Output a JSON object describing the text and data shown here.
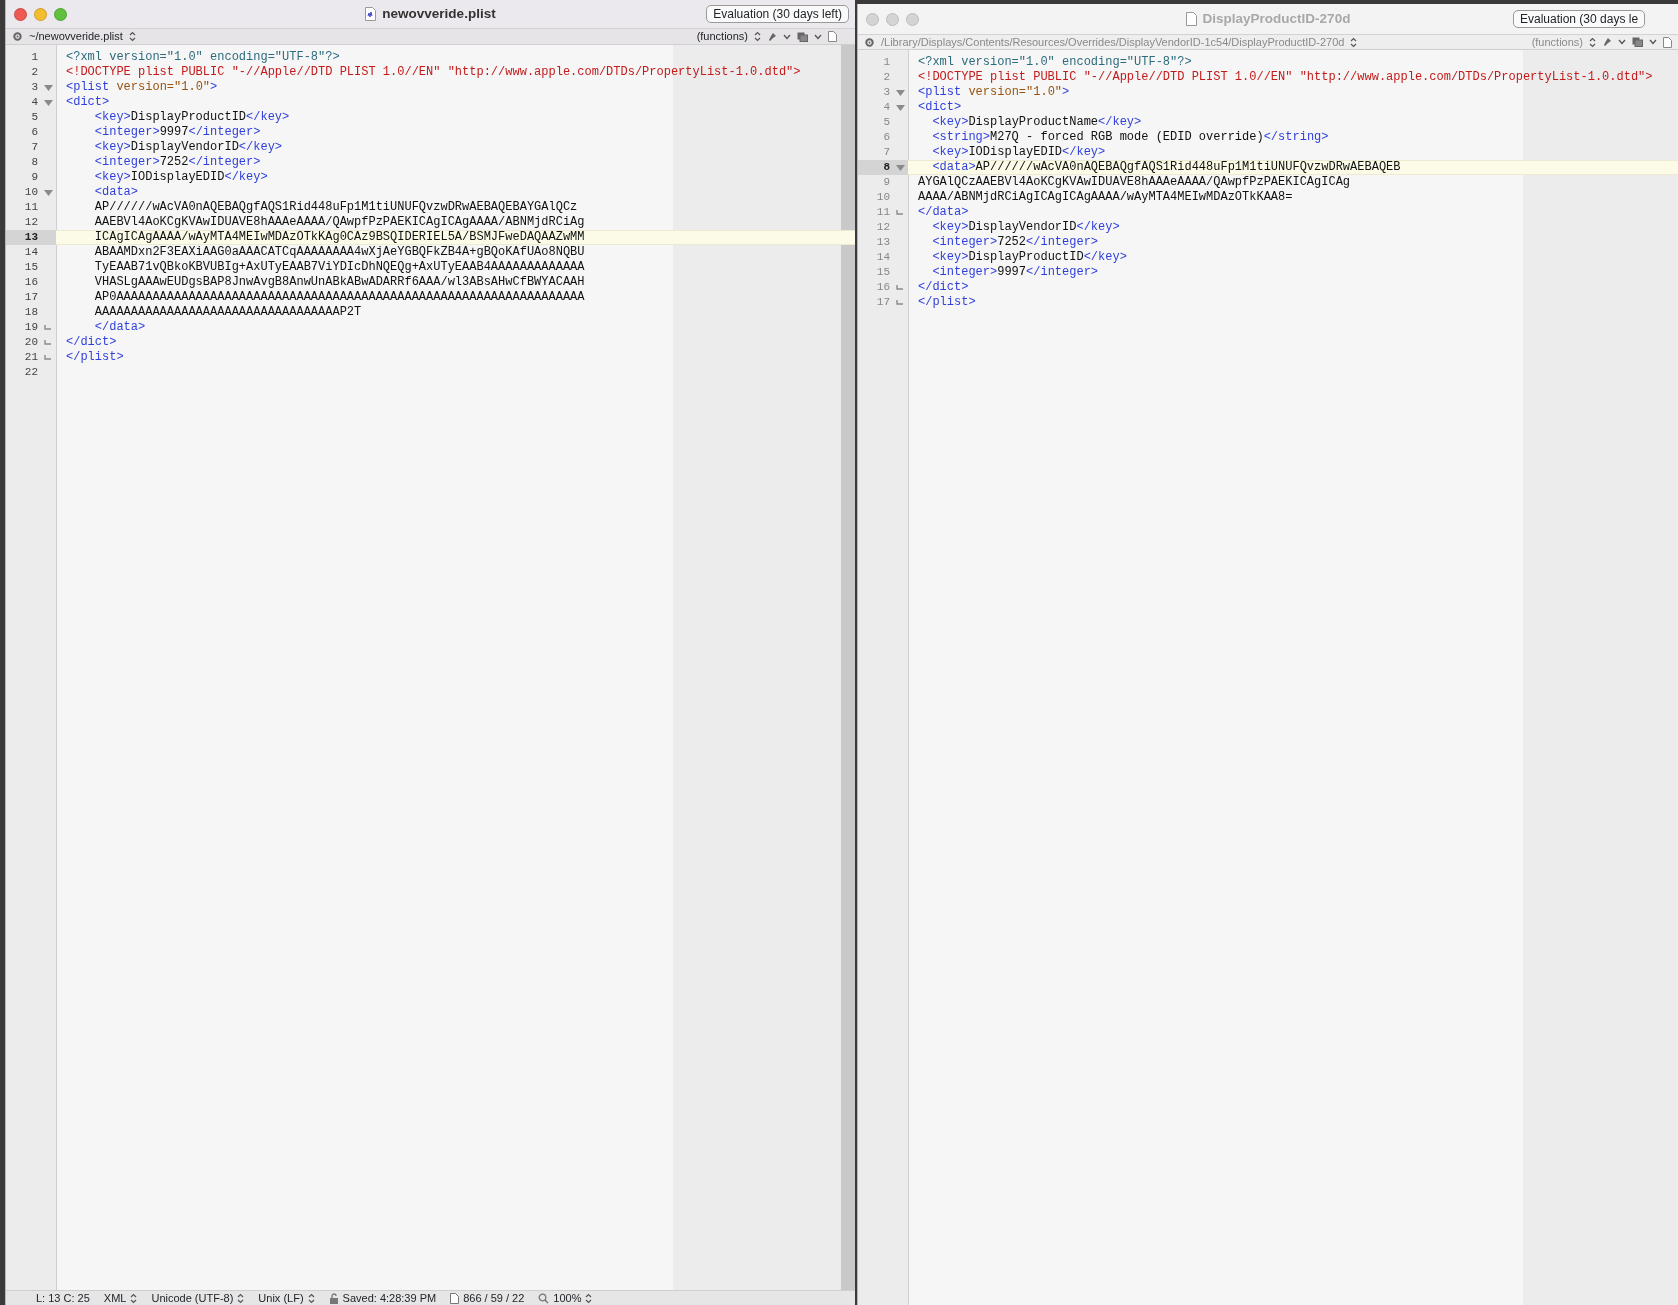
{
  "windows": [
    {
      "title": "newovveride.plist",
      "active": true,
      "badge": "Evaluation (30 days left)",
      "path": "~/newovveride.plist",
      "functions": "(functions)",
      "lines": [
        {
          "number": "1",
          "current": false,
          "fold_open": false,
          "fold_end": false,
          "tokens": [
            {
              "kind": "pi",
              "text": "<?xml version=\"1.0\" encoding=\"UTF-8\"?>"
            }
          ]
        },
        {
          "number": "2",
          "current": false,
          "fold_open": false,
          "fold_end": false,
          "tokens": [
            {
              "kind": "doctype",
              "text": "<!DOCTYPE plist PUBLIC \"-//Apple//DTD PLIST 1.0//EN\" \"http://www.apple.com/DTDs/PropertyList-1.0.dtd\">"
            }
          ]
        },
        {
          "number": "3",
          "current": false,
          "fold_open": true,
          "fold_end": false,
          "tokens": [
            {
              "kind": "tag",
              "text": "<plist"
            },
            {
              "kind": "attr",
              "text": " version=\"1.0\""
            },
            {
              "kind": "tag",
              "text": ">"
            }
          ]
        },
        {
          "number": "4",
          "current": false,
          "fold_open": true,
          "fold_end": false,
          "tokens": [
            {
              "kind": "tag",
              "text": "<dict>"
            }
          ]
        },
        {
          "number": "5",
          "current": false,
          "fold_open": false,
          "fold_end": false,
          "tokens": [
            {
              "kind": "tag",
              "text": "    <key>"
            },
            {
              "kind": "text",
              "text": "DisplayProductID"
            },
            {
              "kind": "tag",
              "text": "</key>"
            }
          ]
        },
        {
          "number": "6",
          "current": false,
          "fold_open": false,
          "fold_end": false,
          "tokens": [
            {
              "kind": "tag",
              "text": "    <integer>"
            },
            {
              "kind": "text",
              "text": "9997"
            },
            {
              "kind": "tag",
              "text": "</integer>"
            }
          ]
        },
        {
          "number": "7",
          "current": false,
          "fold_open": false,
          "fold_end": false,
          "tokens": [
            {
              "kind": "tag",
              "text": "    <key>"
            },
            {
              "kind": "text",
              "text": "DisplayVendorID"
            },
            {
              "kind": "tag",
              "text": "</key>"
            }
          ]
        },
        {
          "number": "8",
          "current": false,
          "fold_open": false,
          "fold_end": false,
          "tokens": [
            {
              "kind": "tag",
              "text": "    <integer>"
            },
            {
              "kind": "text",
              "text": "7252"
            },
            {
              "kind": "tag",
              "text": "</integer>"
            }
          ]
        },
        {
          "number": "9",
          "current": false,
          "fold_open": false,
          "fold_end": false,
          "tokens": [
            {
              "kind": "tag",
              "text": "    <key>"
            },
            {
              "kind": "text",
              "text": "IODisplayEDID"
            },
            {
              "kind": "tag",
              "text": "</key>"
            }
          ]
        },
        {
          "number": "10",
          "current": false,
          "fold_open": true,
          "fold_end": false,
          "tokens": [
            {
              "kind": "tag",
              "text": "    <data>"
            }
          ]
        },
        {
          "number": "11",
          "current": false,
          "fold_open": false,
          "fold_end": false,
          "tokens": [
            {
              "kind": "text",
              "text": "    AP//////wAcVA0nAQEBAQgfAQS1Rid448uFp1M1tiUNUFQvzwDRwAEBAQEBAYGAlQCz"
            }
          ]
        },
        {
          "number": "12",
          "current": false,
          "fold_open": false,
          "fold_end": false,
          "tokens": [
            {
              "kind": "text",
              "text": "    AAEBVl4AoKCgKVAwIDUAVE8hAAAeAAAA/QAwpfPzPAEKICAgICAgAAAA/ABNMjdRCiAg"
            }
          ]
        },
        {
          "number": "13",
          "current": true,
          "fold_open": false,
          "fold_end": false,
          "tokens": [
            {
              "kind": "text",
              "text": "    ICAgICAgAAAA/wAyMTA4MEIwMDAzOTkKAg0CAz9BSQIDERIEL5A/BSMJFweDAQAAZwMM"
            }
          ]
        },
        {
          "number": "14",
          "current": false,
          "fold_open": false,
          "fold_end": false,
          "tokens": [
            {
              "kind": "text",
              "text": "    ABAAMDxn2F3EAXiAAG0aAAACATCqAAAAAAAA4wXjAeYGBQFkZB4A+gBQoKAfUAo8NQBU"
            }
          ]
        },
        {
          "number": "15",
          "current": false,
          "fold_open": false,
          "fold_end": false,
          "tokens": [
            {
              "kind": "text",
              "text": "    TyEAAB71vQBkoKBVUBIg+AxUTyEAAB7ViYDIcDhNQEQg+AxUTyEAAB4AAAAAAAAAAAAA"
            }
          ]
        },
        {
          "number": "16",
          "current": false,
          "fold_open": false,
          "fold_end": false,
          "tokens": [
            {
              "kind": "text",
              "text": "    VHASLgAAAwEUDgsBAP8JnwAvgB8AnwUnABkABwADARRf6AAA/wl3ABsAHwCfBWYACAAH"
            }
          ]
        },
        {
          "number": "17",
          "current": false,
          "fold_open": false,
          "fold_end": false,
          "tokens": [
            {
              "kind": "text",
              "text": "    AP0AAAAAAAAAAAAAAAAAAAAAAAAAAAAAAAAAAAAAAAAAAAAAAAAAAAAAAAAAAAAAAAAA"
            }
          ]
        },
        {
          "number": "18",
          "current": false,
          "fold_open": false,
          "fold_end": false,
          "tokens": [
            {
              "kind": "text",
              "text": "    AAAAAAAAAAAAAAAAAAAAAAAAAAAAAAAAAAP2T"
            }
          ]
        },
        {
          "number": "19",
          "current": false,
          "fold_open": false,
          "fold_end": true,
          "tokens": [
            {
              "kind": "tag",
              "text": "    </data>"
            }
          ]
        },
        {
          "number": "20",
          "current": false,
          "fold_open": false,
          "fold_end": true,
          "tokens": [
            {
              "kind": "tag",
              "text": "</dict>"
            }
          ]
        },
        {
          "number": "21",
          "current": false,
          "fold_open": false,
          "fold_end": true,
          "tokens": [
            {
              "kind": "tag",
              "text": "</plist>"
            }
          ]
        },
        {
          "number": "22",
          "current": false,
          "fold_open": false,
          "fold_end": false
        }
      ],
      "status_bar": [
        {
          "text": "L: 13 C: 25",
          "popup": false
        },
        {
          "text": "XML",
          "popup": true
        },
        {
          "text": "Unicode (UTF-8)",
          "popup": true
        },
        {
          "text": "Unix (LF)",
          "popup": true
        },
        {
          "text": "Saved: 4:28:39 PM",
          "popup": false
        },
        {
          "text": "866 / 59 / 22",
          "popup": false
        },
        {
          "text": "100%",
          "popup": true
        }
      ]
    },
    {
      "title": "DisplayProductID-270d",
      "active": false,
      "badge": "Evaluation (30 days le",
      "path": "/Library/Displays/Contents/Resources/Overrides/DisplayVendorID-1c54/DisplayProductID-270d",
      "functions": "(functions)",
      "lines": [
        {
          "number": "1",
          "current": false,
          "fold_open": false,
          "fold_end": false,
          "tokens": [
            {
              "kind": "pi",
              "text": "<?xml version=\"1.0\" encoding=\"UTF-8\"?>"
            }
          ]
        },
        {
          "number": "2",
          "current": false,
          "fold_open": false,
          "fold_end": false,
          "tokens": [
            {
              "kind": "doctype",
              "text": "<!DOCTYPE plist PUBLIC \"-//Apple//DTD PLIST 1.0//EN\" \"http://www.apple.com/DTDs/PropertyList-1.0.dtd\">"
            }
          ]
        },
        {
          "number": "3",
          "current": false,
          "fold_open": true,
          "fold_end": false,
          "tokens": [
            {
              "kind": "tag",
              "text": "<plist"
            },
            {
              "kind": "attr",
              "text": " version=\"1.0\""
            },
            {
              "kind": "tag",
              "text": ">"
            }
          ]
        },
        {
          "number": "4",
          "current": false,
          "fold_open": true,
          "fold_end": false,
          "tokens": [
            {
              "kind": "tag",
              "text": "<dict>"
            }
          ]
        },
        {
          "number": "5",
          "current": false,
          "fold_open": false,
          "fold_end": false,
          "tokens": [
            {
              "kind": "tag",
              "text": "  <key>"
            },
            {
              "kind": "text",
              "text": "DisplayProductName"
            },
            {
              "kind": "tag",
              "text": "</key>"
            }
          ]
        },
        {
          "number": "6",
          "current": false,
          "fold_open": false,
          "fold_end": false,
          "tokens": [
            {
              "kind": "tag",
              "text": "  <string>"
            },
            {
              "kind": "text",
              "text": "M27Q - forced RGB mode (EDID override)"
            },
            {
              "kind": "tag",
              "text": "</string>"
            }
          ]
        },
        {
          "number": "7",
          "current": false,
          "fold_open": false,
          "fold_end": false,
          "tokens": [
            {
              "kind": "tag",
              "text": "  <key>"
            },
            {
              "kind": "text",
              "text": "IODisplayEDID"
            },
            {
              "kind": "tag",
              "text": "</key>"
            }
          ]
        },
        {
          "number": "8",
          "current": true,
          "fold_open": true,
          "fold_end": false,
          "tokens": [
            {
              "kind": "tag",
              "text": "  <data>"
            },
            {
              "kind": "text",
              "text": "AP//////wAcVA0nAQEBAQgfAQS1Rid448uFp1M1tiUNUFQvzwDRwAEBAQEB"
            }
          ]
        },
        {
          "number": "9",
          "current": false,
          "fold_open": false,
          "fold_end": false,
          "tokens": [
            {
              "kind": "text",
              "text": "AYGAlQCzAAEBVl4AoKCgKVAwIDUAVE8hAAAeAAAA/QAwpfPzPAEKICAgICAg"
            }
          ]
        },
        {
          "number": "10",
          "current": false,
          "fold_open": false,
          "fold_end": false,
          "tokens": [
            {
              "kind": "text",
              "text": "AAAA/ABNMjdRCiAgICAgICAgAAAA/wAyMTA4MEIwMDAzOTkKAA8="
            }
          ]
        },
        {
          "number": "11",
          "current": false,
          "fold_open": false,
          "fold_end": true,
          "tokens": [
            {
              "kind": "tag",
              "text": "</data>"
            }
          ]
        },
        {
          "number": "12",
          "current": false,
          "fold_open": false,
          "fold_end": false,
          "tokens": [
            {
              "kind": "tag",
              "text": "  <key>"
            },
            {
              "kind": "text",
              "text": "DisplayVendorID"
            },
            {
              "kind": "tag",
              "text": "</key>"
            }
          ]
        },
        {
          "number": "13",
          "current": false,
          "fold_open": false,
          "fold_end": false,
          "tokens": [
            {
              "kind": "tag",
              "text": "  <integer>"
            },
            {
              "kind": "text",
              "text": "7252"
            },
            {
              "kind": "tag",
              "text": "</integer>"
            }
          ]
        },
        {
          "number": "14",
          "current": false,
          "fold_open": false,
          "fold_end": false,
          "tokens": [
            {
              "kind": "tag",
              "text": "  <key>"
            },
            {
              "kind": "text",
              "text": "DisplayProductID"
            },
            {
              "kind": "tag",
              "text": "</key>"
            }
          ]
        },
        {
          "number": "15",
          "current": false,
          "fold_open": false,
          "fold_end": false,
          "tokens": [
            {
              "kind": "tag",
              "text": "  <integer>"
            },
            {
              "kind": "text",
              "text": "9997"
            },
            {
              "kind": "tag",
              "text": "</integer>"
            }
          ]
        },
        {
          "number": "16",
          "current": false,
          "fold_open": false,
          "fold_end": true,
          "tokens": [
            {
              "kind": "tag",
              "text": "</dict>"
            }
          ]
        },
        {
          "number": "17",
          "current": false,
          "fold_open": false,
          "fold_end": true,
          "tokens": [
            {
              "kind": "tag",
              "text": "</plist>"
            }
          ]
        }
      ]
    }
  ]
}
